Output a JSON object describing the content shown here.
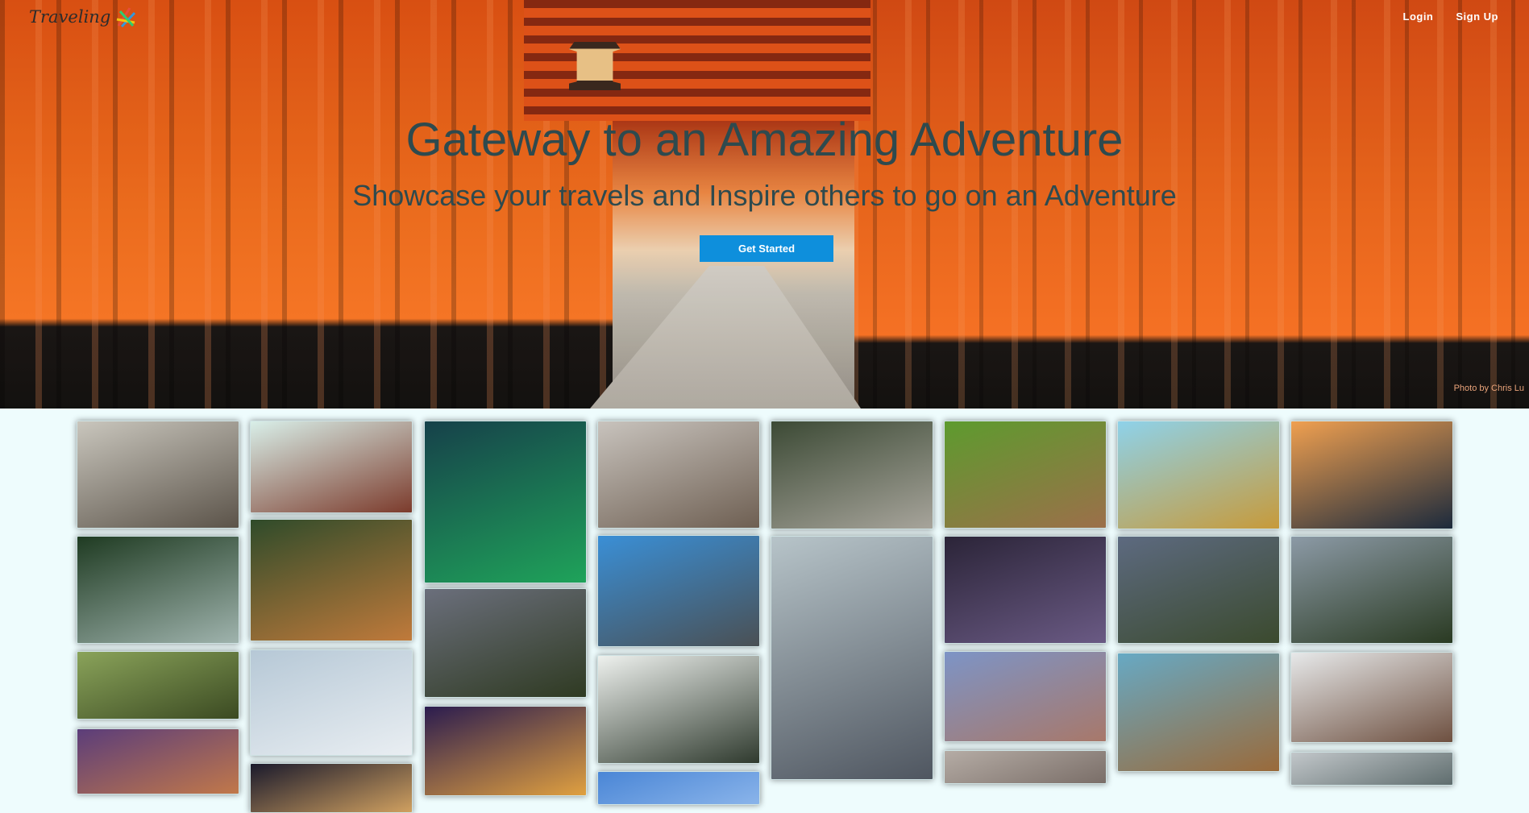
{
  "header": {
    "brand": "Traveling",
    "nav": {
      "login": "Login",
      "signup": "Sign Up"
    }
  },
  "hero": {
    "title": "Gateway to an Amazing Adventure",
    "subtitle": "Showcase your travels and Inspire others to go on an Adventure",
    "cta_label": "Get Started",
    "credit": "Photo by Chris Lu"
  },
  "colors": {
    "page_bg": "#eefcfd",
    "cta_bg": "#0e8fdc",
    "title_text": "#2e4a4e"
  },
  "gallery": {
    "columns": [
      [
        {
          "name": "polar-bear-photo",
          "colors": [
            "#c9c6bd",
            "#5b5349"
          ]
        },
        {
          "name": "jungle-waterfall-photo",
          "colors": [
            "#1f3b22",
            "#9fb3ad"
          ]
        },
        {
          "name": "forest-fantasy-house-photo",
          "colors": [
            "#8aa35a",
            "#3b4a22"
          ]
        },
        {
          "name": "canal-houses-photo",
          "colors": [
            "#5b3d7a",
            "#c1784a"
          ]
        }
      ],
      [
        {
          "name": "red-temple-garden-photo",
          "colors": [
            "#d9efe9",
            "#7c3b2c"
          ]
        },
        {
          "name": "tiger-roaring-photo",
          "colors": [
            "#2f4b2a",
            "#c07a3b"
          ]
        },
        {
          "name": "snowy-field-photo",
          "colors": [
            "#b6c8d6",
            "#e9eef2"
          ]
        },
        {
          "name": "night-bridge-arch-photo",
          "colors": [
            "#1a1a2c",
            "#d0a060"
          ]
        }
      ],
      [
        {
          "name": "northern-lights-photo",
          "colors": [
            "#16414a",
            "#1fa35a"
          ]
        },
        {
          "name": "cave-waterfall-sunset-photo",
          "colors": [
            "#6b6f7c",
            "#2f3a22"
          ]
        },
        {
          "name": "purple-night-city-photo",
          "colors": [
            "#2b1c4f",
            "#e0a040"
          ]
        }
      ],
      [
        {
          "name": "sleeping-cat-photo",
          "colors": [
            "#c8c3bd",
            "#6e5f52"
          ]
        },
        {
          "name": "coastal-road-photo",
          "colors": [
            "#3a8fd6",
            "#4a5054"
          ]
        },
        {
          "name": "misty-forest-path-photo",
          "colors": [
            "#eef1ee",
            "#2f3a2e"
          ]
        },
        {
          "name": "blue-sky-photo",
          "colors": [
            "#4a86d6",
            "#8ab4ea"
          ]
        }
      ],
      [
        {
          "name": "shrine-gate-path-photo",
          "colors": [
            "#3c4a35",
            "#a7a49b"
          ]
        },
        {
          "name": "tokyo-tower-skyline-photo",
          "colors": [
            "#b7c4c9",
            "#4f5660"
          ]
        }
      ],
      [
        {
          "name": "kangaroo-photo",
          "colors": [
            "#5d9b2e",
            "#9c6f4a"
          ]
        },
        {
          "name": "city-bridge-night-photo",
          "colors": [
            "#2b2438",
            "#6a5a84"
          ]
        },
        {
          "name": "lake-house-mountains-photo",
          "colors": [
            "#7d94c6",
            "#a8786a"
          ]
        },
        {
          "name": "rooftops-town-photo",
          "colors": [
            "#b5aca5",
            "#7a6e68"
          ]
        }
      ],
      [
        {
          "name": "pineapples-water-photo",
          "colors": [
            "#8ed2ea",
            "#c79a3a"
          ]
        },
        {
          "name": "waterfall-cave-photo",
          "colors": [
            "#5d6a80",
            "#3b4a2e"
          ]
        },
        {
          "name": "fantasy-village-street-photo",
          "colors": [
            "#67a9c4",
            "#9a6a3a"
          ]
        }
      ],
      [
        {
          "name": "city-skyline-waterfront-photo",
          "colors": [
            "#f0a050",
            "#1c2a3c"
          ]
        },
        {
          "name": "forested-mountains-photo",
          "colors": [
            "#8c9aa6",
            "#2a3a22"
          ]
        },
        {
          "name": "deer-in-snow-photo",
          "colors": [
            "#e7e9ea",
            "#6e5040"
          ]
        },
        {
          "name": "cloudy-landscape-photo",
          "colors": [
            "#c2c7ca",
            "#5f6d6e"
          ]
        }
      ]
    ]
  }
}
